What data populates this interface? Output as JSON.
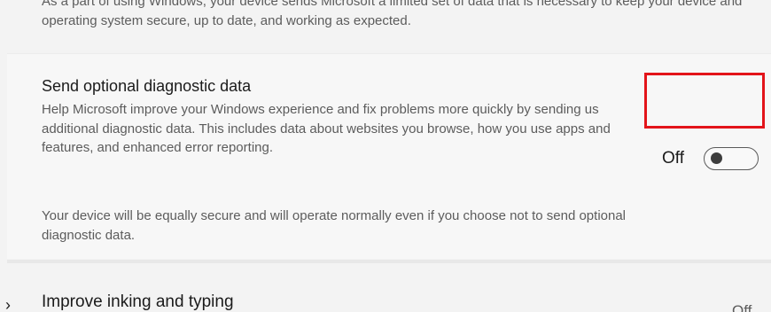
{
  "intro": {
    "text": "As a part of using Windows, your device sends Microsoft a limited set of data that is necessary to keep your device and operating system secure, up to date, and working as expected."
  },
  "optional_diagnostic": {
    "title": "Send optional diagnostic data",
    "description": "Help Microsoft improve your Windows experience and fix problems more quickly by sending us additional diagnostic data. This includes data about websites you browse, how you use apps and features, and enhanced error reporting.",
    "note": "Your device will be equally secure and will operate normally even if you choose not to send optional diagnostic data.",
    "toggle": {
      "state_label": "Off",
      "checked": false
    },
    "highlight_color": "#e3141a"
  },
  "next_setting": {
    "icon": "chevron-icon",
    "title": "Improve inking and typing",
    "status": "Off"
  }
}
